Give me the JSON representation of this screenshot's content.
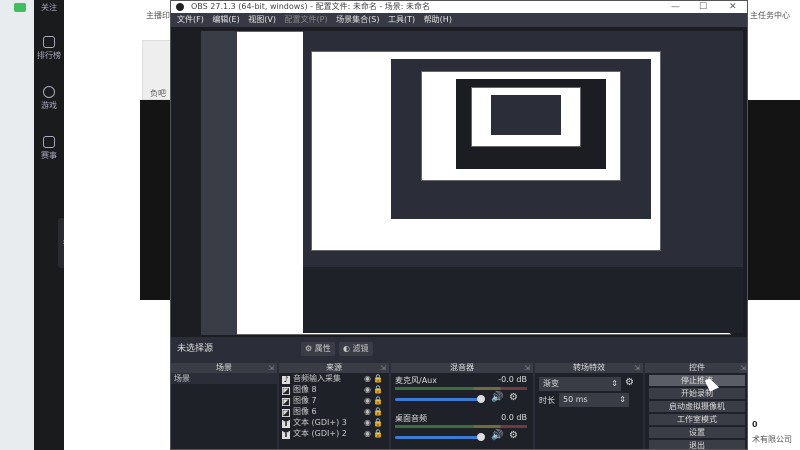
{
  "background": {
    "sidebar": [
      {
        "label": "关注",
        "icon": "heart-icon"
      },
      {
        "label": "排行榜",
        "icon": "ranking-icon"
      },
      {
        "label": "游戏",
        "icon": "game-icon"
      },
      {
        "label": "赛事",
        "icon": "trophy-icon"
      }
    ],
    "text_top": "主播印",
    "text_right_top": "主任务中心",
    "text_card": "负吧",
    "text_num": "0",
    "text_company": "术有限公司"
  },
  "obs": {
    "title": "OBS 27.1.3 (64-bit, windows) - 配置文件: 未命名 - 场景: 未命名",
    "window_controls": [
      "—",
      "☐",
      "✕"
    ],
    "menu": [
      {
        "label": "文件(F)",
        "disabled": false
      },
      {
        "label": "编辑(E)",
        "disabled": false
      },
      {
        "label": "视图(V)",
        "disabled": false
      },
      {
        "label": "配置文件(P)",
        "disabled": true
      },
      {
        "label": "场景集合(S)",
        "disabled": false
      },
      {
        "label": "工具(T)",
        "disabled": false
      },
      {
        "label": "帮助(H)",
        "disabled": false
      }
    ],
    "source_bar": {
      "label": "未选择源",
      "properties": "属性",
      "filters": "滤镜"
    },
    "scenes": {
      "header": "场景",
      "items": [
        "场景"
      ]
    },
    "sources": {
      "header": "来源",
      "items": [
        {
          "name": "音频输入采集",
          "icon": "mic-icon"
        },
        {
          "name": "图像 8",
          "icon": "image-icon"
        },
        {
          "name": "图像 7",
          "icon": "image-icon"
        },
        {
          "name": "图像 6",
          "icon": "image-icon"
        },
        {
          "name": "文本 (GDI+) 3",
          "icon": "text-icon"
        },
        {
          "name": "文本 (GDI+) 2",
          "icon": "text-icon"
        }
      ]
    },
    "mixer": {
      "header": "混音器",
      "channels": [
        {
          "name": "麦克风/Aux",
          "db": "-0.0 dB"
        },
        {
          "name": "桌面音频",
          "db": "0.0 dB"
        }
      ]
    },
    "transitions": {
      "header": "转场特效",
      "type": "渐变",
      "duration_label": "时长",
      "duration": "50 ms"
    },
    "controls": {
      "header": "控件",
      "buttons": [
        "停止推流",
        "开始录制",
        "启动虚拟摄像机",
        "工作室模式",
        "设置",
        "退出"
      ]
    }
  }
}
